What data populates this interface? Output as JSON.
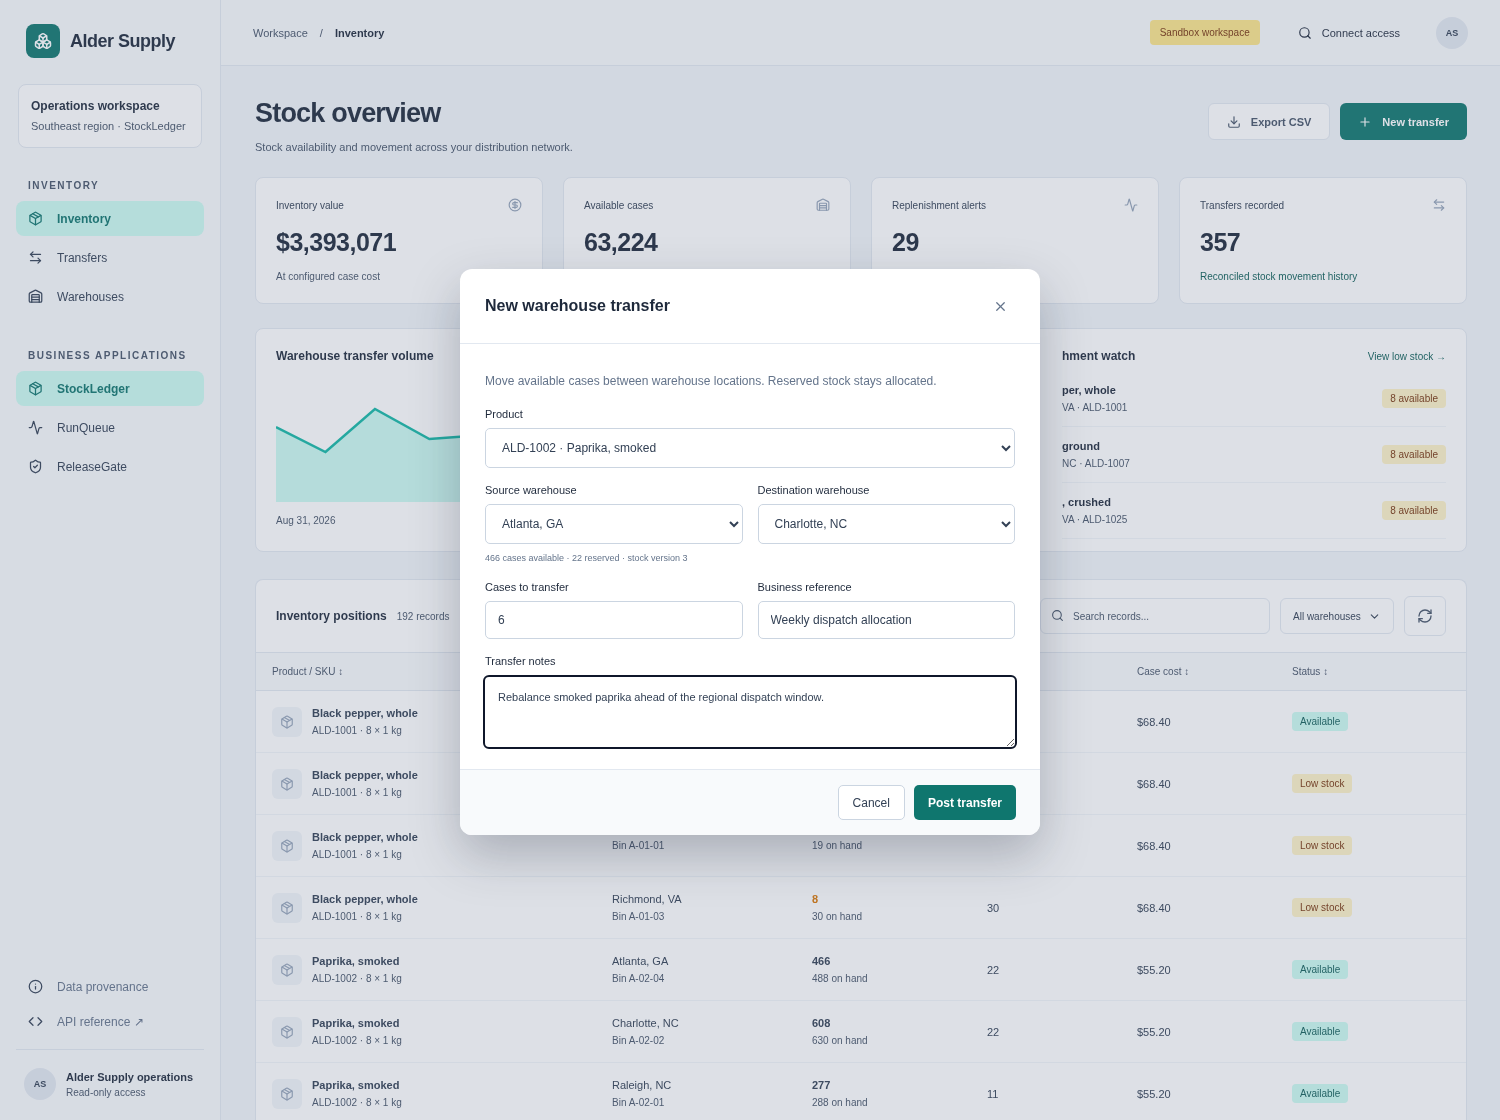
{
  "sidebar": {
    "brand": "Alder Supply",
    "workspace": {
      "title": "Operations workspace",
      "subtitle": "Southeast region · StockLedger"
    },
    "sections": [
      {
        "heading": "INVENTORY",
        "items": [
          {
            "label": "Inventory",
            "selected": true
          },
          {
            "label": "Transfers",
            "selected": false
          },
          {
            "label": "Warehouses",
            "selected": false
          }
        ]
      },
      {
        "heading": "BUSINESS APPLICATIONS",
        "items": [
          {
            "label": "StockLedger",
            "selected": true
          },
          {
            "label": "RunQueue",
            "selected": false
          },
          {
            "label": "ReleaseGate",
            "selected": false
          }
        ]
      }
    ],
    "footer_links": [
      "Data provenance",
      "API reference ↗"
    ],
    "user": {
      "initials": "AS",
      "name": "Alder Supply operations",
      "role": "Read-only access"
    }
  },
  "topbar": {
    "breadcrumb": [
      "Workspace",
      "Inventory"
    ],
    "separator": "/",
    "badge": "Sandbox workspace",
    "connect": "Connect access",
    "avatar": "AS"
  },
  "header": {
    "title": "Stock overview",
    "subtitle": "Stock availability and movement across your distribution network.",
    "buttons": [
      {
        "label": "Export CSV",
        "kind": "secondary"
      },
      {
        "label": "New transfer",
        "kind": "primary"
      }
    ]
  },
  "stats": [
    {
      "label": "Inventory value",
      "value": "$3,393,071",
      "note": {
        "text": "At configured case cost",
        "kind": "muted"
      }
    },
    {
      "label": "Available cases",
      "value": "63,224"
    },
    {
      "label": "Replenishment alerts",
      "value": "29"
    },
    {
      "label": "Transfers recorded",
      "value": "357",
      "note": {
        "text": "Reconciled stock movement history",
        "kind": "positive"
      }
    }
  ],
  "chart_card": {
    "title": "Warehouse transfer volume",
    "date_label": "Aug 31, 2026"
  },
  "watch_card": {
    "title": "hment watch",
    "link": "View low stock →",
    "items": [
      {
        "name": "per, whole",
        "meta": "VA · ALD-1001",
        "badge": "8 available"
      },
      {
        "name": "ground",
        "meta": "NC · ALD-1007",
        "badge": "8 available"
      },
      {
        "name": ", crushed",
        "meta": "VA · ALD-1025",
        "badge": "8 available"
      }
    ]
  },
  "table": {
    "title": "Inventory positions",
    "count": "192 records",
    "search_placeholder": "Search records...",
    "filter": "All warehouses",
    "columns": [
      "Product / SKU ↕",
      "Case cost ↕",
      "Status ↕"
    ],
    "rows": [
      {
        "product": "Black pepper, whole",
        "sku": "ALD-1001 · 8 × 1 kg",
        "cost": "$68.40",
        "status": {
          "label": "Available",
          "kind": "available"
        }
      },
      {
        "product": "Black pepper, whole",
        "sku": "ALD-1001 · 8 × 1 kg",
        "cost": "$68.40",
        "status": {
          "label": "Low stock",
          "kind": "low"
        }
      },
      {
        "product": "Black pepper, whole",
        "sku": "ALD-1001 · 8 × 1 kg",
        "bin": "Bin A-01-01",
        "on_hand": "19 on hand",
        "cost": "$68.40",
        "status": {
          "label": "Low stock",
          "kind": "low"
        }
      },
      {
        "product": "Black pepper, whole",
        "sku": "ALD-1001 · 8 × 1 kg",
        "warehouse": "Richmond, VA",
        "bin": "Bin A-01-03",
        "available": "8",
        "low": true,
        "on_hand": "30 on hand",
        "reserved": "30",
        "cost": "$68.40",
        "status": {
          "label": "Low stock",
          "kind": "low"
        }
      },
      {
        "product": "Paprika, smoked",
        "sku": "ALD-1002 · 8 × 1 kg",
        "warehouse": "Atlanta, GA",
        "bin": "Bin A-02-04",
        "available": "466",
        "low": false,
        "on_hand": "488 on hand",
        "reserved": "22",
        "cost": "$55.20",
        "status": {
          "label": "Available",
          "kind": "available"
        }
      },
      {
        "product": "Paprika, smoked",
        "sku": "ALD-1002 · 8 × 1 kg",
        "warehouse": "Charlotte, NC",
        "bin": "Bin A-02-02",
        "available": "608",
        "low": false,
        "on_hand": "630 on hand",
        "reserved": "22",
        "cost": "$55.20",
        "status": {
          "label": "Available",
          "kind": "available"
        }
      },
      {
        "product": "Paprika, smoked",
        "sku": "ALD-1002 · 8 × 1 kg",
        "warehouse": "Raleigh, NC",
        "bin": "Bin A-02-01",
        "available": "277",
        "low": false,
        "on_hand": "288 on hand",
        "reserved": "11",
        "cost": "$55.20",
        "status": {
          "label": "Available",
          "kind": "available"
        }
      }
    ]
  },
  "modal": {
    "title": "New warehouse transfer",
    "description": "Move available cases between warehouse locations. Reserved stock stays allocated.",
    "product": {
      "label": "Product",
      "value": "ALD-1002 · Paprika, smoked"
    },
    "source": {
      "label": "Source warehouse",
      "value": "Atlanta, GA"
    },
    "destination": {
      "label": "Destination warehouse",
      "value": "Charlotte, NC"
    },
    "stock_hint": "466 cases available · 22 reserved · stock version 3",
    "cases": {
      "label": "Cases to transfer",
      "value": "6"
    },
    "reference": {
      "label": "Business reference",
      "value": "Weekly dispatch allocation"
    },
    "notes": {
      "label": "Transfer notes",
      "value": "Rebalance smoked paprika ahead of the regional dispatch window.",
      "focused": true
    },
    "buttons": [
      {
        "label": "Cancel",
        "kind": "secondary"
      },
      {
        "label": "Post transfer",
        "kind": "primary"
      }
    ]
  }
}
